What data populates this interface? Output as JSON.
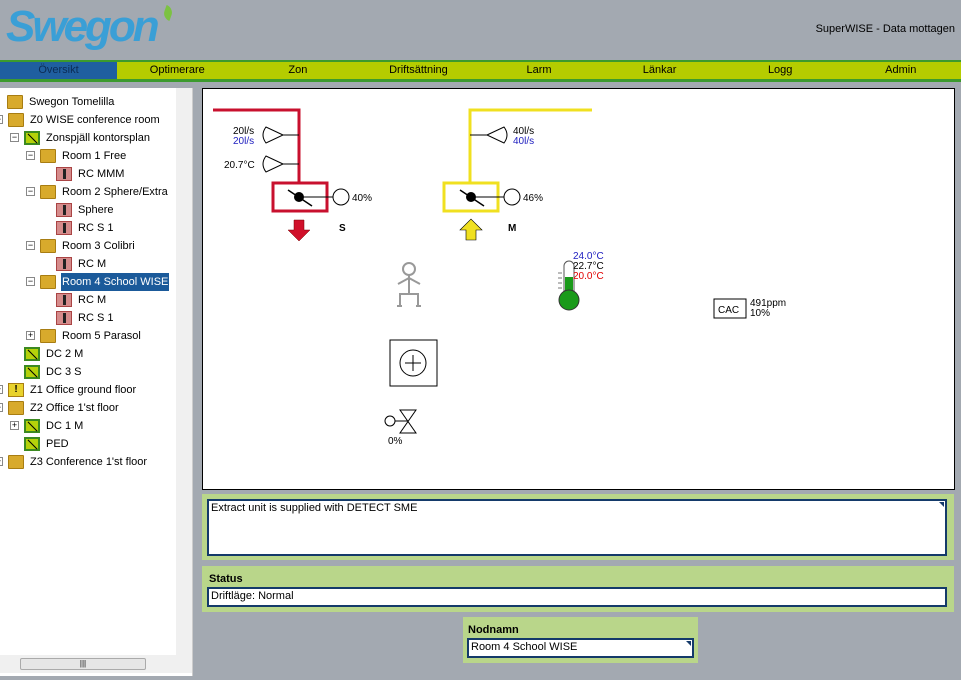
{
  "header": {
    "logo": "Swegon",
    "status": "SuperWISE - Data mottagen"
  },
  "nav": [
    {
      "label": "Översikt",
      "selected": true
    },
    {
      "label": "Optimerare"
    },
    {
      "label": "Zon"
    },
    {
      "label": "Driftsättning"
    },
    {
      "label": "Larm"
    },
    {
      "label": "Länkar"
    },
    {
      "label": "Logg"
    },
    {
      "label": "Admin"
    }
  ],
  "tree": [
    {
      "label": "Swegon Tomelilla",
      "level": 0,
      "icon": "folder",
      "exp": ""
    },
    {
      "label": "Z0 WISE conference room",
      "level": 1,
      "icon": "folder",
      "exp": "-"
    },
    {
      "label": "Zonspjäll kontorsplan",
      "level": 2,
      "icon": "damper",
      "exp": "-"
    },
    {
      "label": "Room 1 Free",
      "level": 3,
      "icon": "folder",
      "exp": "-"
    },
    {
      "label": "RC MMM",
      "level": 4,
      "icon": "therm",
      "exp": ""
    },
    {
      "label": "Room 2 Sphere/Extra",
      "level": 3,
      "icon": "folder",
      "exp": "-"
    },
    {
      "label": "Sphere",
      "level": 4,
      "icon": "therm",
      "exp": ""
    },
    {
      "label": "RC S 1",
      "level": 4,
      "icon": "therm",
      "exp": ""
    },
    {
      "label": "Room 3 Colibri",
      "level": 3,
      "icon": "folder",
      "exp": "-"
    },
    {
      "label": "RC M",
      "level": 4,
      "icon": "therm",
      "exp": ""
    },
    {
      "label": "Room 4 School WISE",
      "level": 3,
      "icon": "folder",
      "exp": "-",
      "selected": true
    },
    {
      "label": "RC M",
      "level": 4,
      "icon": "therm",
      "exp": ""
    },
    {
      "label": "RC S 1",
      "level": 4,
      "icon": "therm",
      "exp": ""
    },
    {
      "label": "Room 5 Parasol",
      "level": 3,
      "icon": "folder",
      "exp": "+"
    },
    {
      "label": "DC 2 M",
      "level": 2,
      "icon": "damper",
      "exp": ""
    },
    {
      "label": "DC 3 S",
      "level": 2,
      "icon": "damper",
      "exp": ""
    },
    {
      "label": "Z1 Office ground floor",
      "level": 1,
      "icon": "warn",
      "exp": "+"
    },
    {
      "label": "Z2 Office 1'st floor",
      "level": 1,
      "icon": "folder",
      "exp": "-"
    },
    {
      "label": "DC 1 M",
      "level": 2,
      "icon": "damper",
      "exp": "+"
    },
    {
      "label": "PED",
      "level": 2,
      "icon": "damper",
      "exp": ""
    },
    {
      "label": "Z3 Conference 1'st floor",
      "level": 1,
      "icon": "folder",
      "exp": "+"
    }
  ],
  "diagram": {
    "extract": {
      "flow_actual": "20l/s",
      "flow_setpoint": "20l/s",
      "temp": "20.7°C",
      "damper": "40%",
      "label": "S",
      "color": "#c8102e"
    },
    "supply": {
      "flow_actual": "40l/s",
      "flow_setpoint": "40l/s",
      "damper": "46%",
      "label": "M",
      "color": "#f0e020"
    },
    "room_temp": {
      "high": "24.0°C",
      "actual": "22.7°C",
      "low": "20.0°C"
    },
    "co2": {
      "label": "CAC",
      "ppm": "491ppm",
      "pct": "10%"
    },
    "valve": {
      "pct": "0%"
    }
  },
  "info": {
    "text": "Extract unit is supplied with DETECT SME"
  },
  "status": {
    "label": "Status",
    "value": "Driftläge: Normal"
  },
  "nodename": {
    "label": "Nodnamn",
    "value": "Room 4 School WISE"
  }
}
